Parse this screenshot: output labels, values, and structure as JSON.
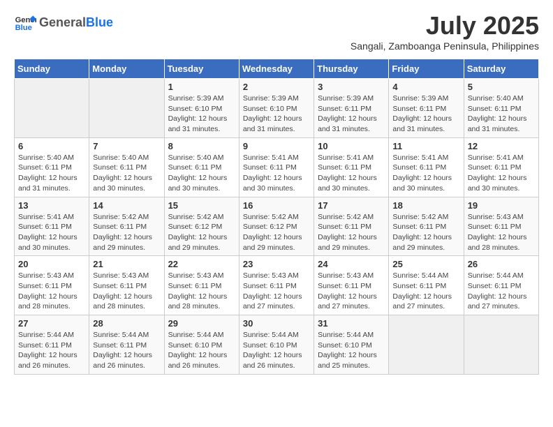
{
  "header": {
    "logo_general": "General",
    "logo_blue": "Blue",
    "title": "July 2025",
    "subtitle": "Sangali, Zamboanga Peninsula, Philippines"
  },
  "calendar": {
    "days_of_week": [
      "Sunday",
      "Monday",
      "Tuesday",
      "Wednesday",
      "Thursday",
      "Friday",
      "Saturday"
    ],
    "weeks": [
      [
        {
          "day": "",
          "info": ""
        },
        {
          "day": "",
          "info": ""
        },
        {
          "day": "1",
          "info": "Sunrise: 5:39 AM\nSunset: 6:10 PM\nDaylight: 12 hours and 31 minutes."
        },
        {
          "day": "2",
          "info": "Sunrise: 5:39 AM\nSunset: 6:10 PM\nDaylight: 12 hours and 31 minutes."
        },
        {
          "day": "3",
          "info": "Sunrise: 5:39 AM\nSunset: 6:11 PM\nDaylight: 12 hours and 31 minutes."
        },
        {
          "day": "4",
          "info": "Sunrise: 5:39 AM\nSunset: 6:11 PM\nDaylight: 12 hours and 31 minutes."
        },
        {
          "day": "5",
          "info": "Sunrise: 5:40 AM\nSunset: 6:11 PM\nDaylight: 12 hours and 31 minutes."
        }
      ],
      [
        {
          "day": "6",
          "info": "Sunrise: 5:40 AM\nSunset: 6:11 PM\nDaylight: 12 hours and 31 minutes."
        },
        {
          "day": "7",
          "info": "Sunrise: 5:40 AM\nSunset: 6:11 PM\nDaylight: 12 hours and 30 minutes."
        },
        {
          "day": "8",
          "info": "Sunrise: 5:40 AM\nSunset: 6:11 PM\nDaylight: 12 hours and 30 minutes."
        },
        {
          "day": "9",
          "info": "Sunrise: 5:41 AM\nSunset: 6:11 PM\nDaylight: 12 hours and 30 minutes."
        },
        {
          "day": "10",
          "info": "Sunrise: 5:41 AM\nSunset: 6:11 PM\nDaylight: 12 hours and 30 minutes."
        },
        {
          "day": "11",
          "info": "Sunrise: 5:41 AM\nSunset: 6:11 PM\nDaylight: 12 hours and 30 minutes."
        },
        {
          "day": "12",
          "info": "Sunrise: 5:41 AM\nSunset: 6:11 PM\nDaylight: 12 hours and 30 minutes."
        }
      ],
      [
        {
          "day": "13",
          "info": "Sunrise: 5:41 AM\nSunset: 6:11 PM\nDaylight: 12 hours and 30 minutes."
        },
        {
          "day": "14",
          "info": "Sunrise: 5:42 AM\nSunset: 6:11 PM\nDaylight: 12 hours and 29 minutes."
        },
        {
          "day": "15",
          "info": "Sunrise: 5:42 AM\nSunset: 6:12 PM\nDaylight: 12 hours and 29 minutes."
        },
        {
          "day": "16",
          "info": "Sunrise: 5:42 AM\nSunset: 6:12 PM\nDaylight: 12 hours and 29 minutes."
        },
        {
          "day": "17",
          "info": "Sunrise: 5:42 AM\nSunset: 6:11 PM\nDaylight: 12 hours and 29 minutes."
        },
        {
          "day": "18",
          "info": "Sunrise: 5:42 AM\nSunset: 6:11 PM\nDaylight: 12 hours and 29 minutes."
        },
        {
          "day": "19",
          "info": "Sunrise: 5:43 AM\nSunset: 6:11 PM\nDaylight: 12 hours and 28 minutes."
        }
      ],
      [
        {
          "day": "20",
          "info": "Sunrise: 5:43 AM\nSunset: 6:11 PM\nDaylight: 12 hours and 28 minutes."
        },
        {
          "day": "21",
          "info": "Sunrise: 5:43 AM\nSunset: 6:11 PM\nDaylight: 12 hours and 28 minutes."
        },
        {
          "day": "22",
          "info": "Sunrise: 5:43 AM\nSunset: 6:11 PM\nDaylight: 12 hours and 28 minutes."
        },
        {
          "day": "23",
          "info": "Sunrise: 5:43 AM\nSunset: 6:11 PM\nDaylight: 12 hours and 27 minutes."
        },
        {
          "day": "24",
          "info": "Sunrise: 5:43 AM\nSunset: 6:11 PM\nDaylight: 12 hours and 27 minutes."
        },
        {
          "day": "25",
          "info": "Sunrise: 5:44 AM\nSunset: 6:11 PM\nDaylight: 12 hours and 27 minutes."
        },
        {
          "day": "26",
          "info": "Sunrise: 5:44 AM\nSunset: 6:11 PM\nDaylight: 12 hours and 27 minutes."
        }
      ],
      [
        {
          "day": "27",
          "info": "Sunrise: 5:44 AM\nSunset: 6:11 PM\nDaylight: 12 hours and 26 minutes."
        },
        {
          "day": "28",
          "info": "Sunrise: 5:44 AM\nSunset: 6:11 PM\nDaylight: 12 hours and 26 minutes."
        },
        {
          "day": "29",
          "info": "Sunrise: 5:44 AM\nSunset: 6:10 PM\nDaylight: 12 hours and 26 minutes."
        },
        {
          "day": "30",
          "info": "Sunrise: 5:44 AM\nSunset: 6:10 PM\nDaylight: 12 hours and 26 minutes."
        },
        {
          "day": "31",
          "info": "Sunrise: 5:44 AM\nSunset: 6:10 PM\nDaylight: 12 hours and 25 minutes."
        },
        {
          "day": "",
          "info": ""
        },
        {
          "day": "",
          "info": ""
        }
      ]
    ]
  }
}
